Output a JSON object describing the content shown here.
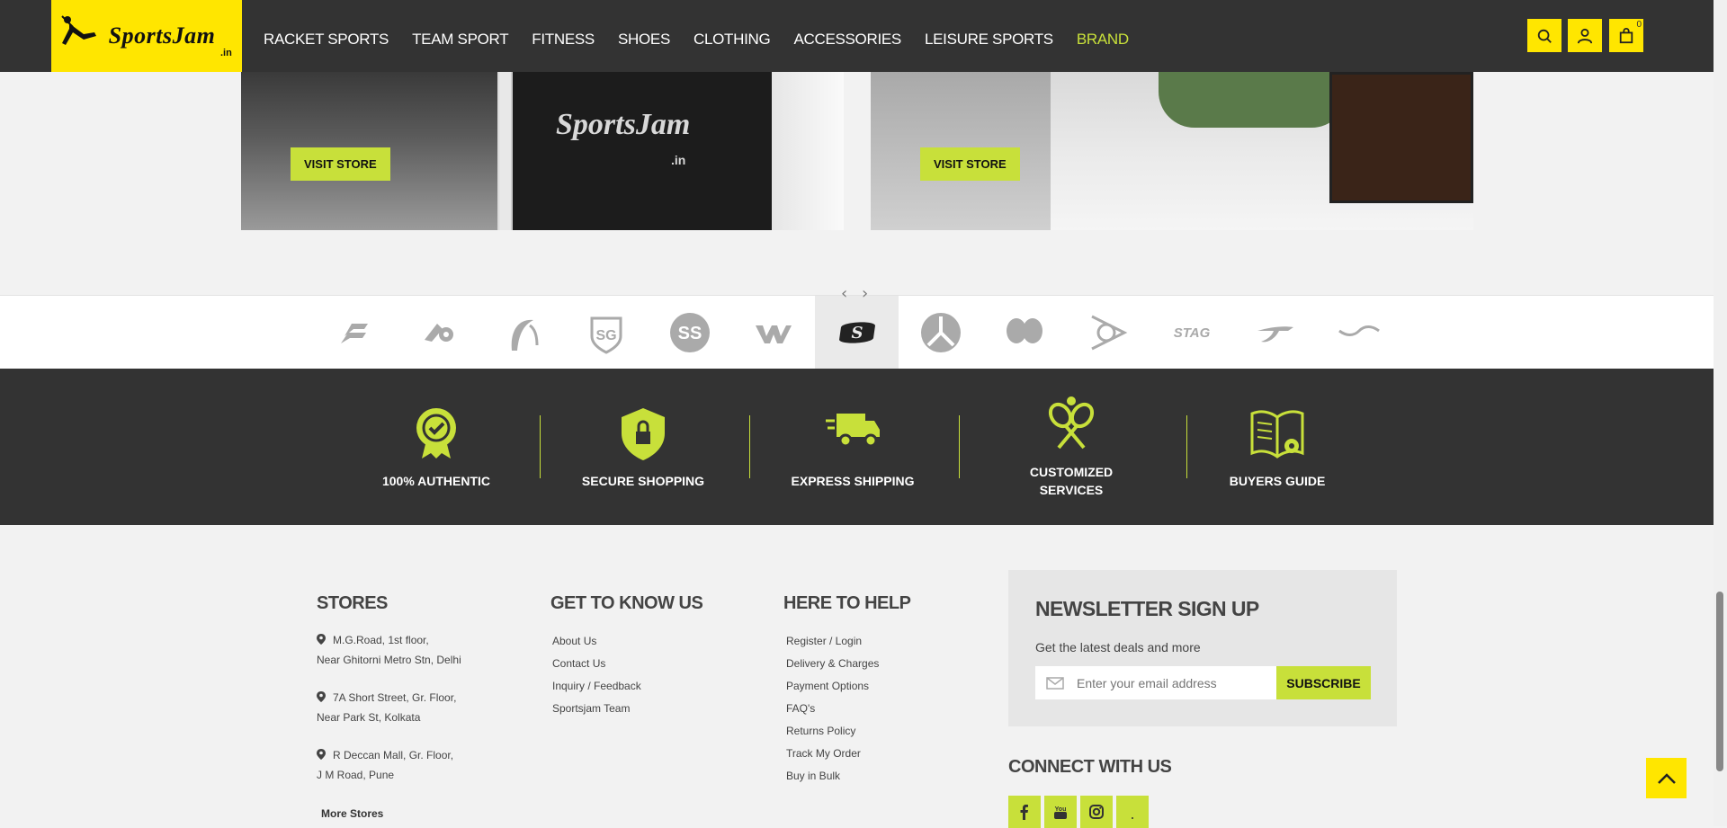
{
  "header": {
    "logo_text": "SportsJam",
    "logo_tld": ".in",
    "nav": [
      "RACKET SPORTS",
      "TEAM SPORT",
      "FITNESS",
      "SHOES",
      "CLOTHING",
      "ACCESSORIES",
      "LEISURE SPORTS",
      "BRAND"
    ],
    "active_nav": "BRAND",
    "cart_count": "0",
    "icons": [
      "search-icon",
      "user-icon",
      "cart-icon"
    ]
  },
  "stores": {
    "left_button": "VISIT STORE",
    "right_button": "VISIT STORE",
    "sign_text": "SportsJam",
    "sign_tld": ".in"
  },
  "brands": {
    "items": [
      "babolat",
      "yonex",
      "head",
      "sg",
      "ss",
      "wilson",
      "skechers",
      "kookaburra",
      "butterfly",
      "dunlop",
      "stag",
      "joma",
      "li-ning"
    ],
    "stag_text": "STAG",
    "selected": "skechers"
  },
  "features": [
    {
      "label": "100% AUTHENTIC"
    },
    {
      "label": "SECURE SHOPPING"
    },
    {
      "label": "EXPRESS SHIPPING"
    },
    {
      "label_line1": "CUSTOMIZED",
      "label_line2": "SERVICES"
    },
    {
      "label": "BUYERS GUIDE"
    }
  ],
  "footer": {
    "stores_title": "STORES",
    "addresses": [
      {
        "line1": "M.G.Road, 1st floor,",
        "line2": "Near Ghitorni Metro Stn, Delhi"
      },
      {
        "line1": "7A Short Street, Gr. Floor,",
        "line2": "Near Park St, Kolkata"
      },
      {
        "line1": "R Deccan Mall, Gr. Floor,",
        "line2": "J M Road, Pune"
      }
    ],
    "more_stores": "More Stores",
    "know_title": "GET TO KNOW US",
    "know_links": [
      "About Us",
      "Contact Us",
      "Inquiry / Feedback",
      "Sportsjam Team"
    ],
    "help_title": "HERE TO HELP",
    "help_links": [
      "Register / Login",
      "Delivery & Charges",
      "Payment Options",
      "FAQ's",
      "Returns Policy",
      "Track My Order",
      "Buy in Bulk"
    ],
    "newsletter_title": "NEWSLETTER SIGN UP",
    "newsletter_sub": "Get the latest deals and more",
    "email_placeholder": "Enter your email address",
    "subscribe": "SUBSCRIBE",
    "connect_title": "CONNECT WITH US",
    "social": [
      "facebook-icon",
      "youtube-icon",
      "instagram-icon",
      "more-icon"
    ]
  },
  "colors": {
    "accent": "#c8e03a",
    "brand_yellow": "#ffe600",
    "dark": "#333333"
  }
}
